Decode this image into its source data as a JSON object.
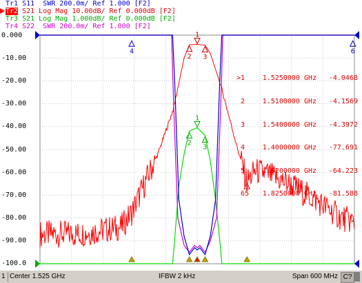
{
  "traces": [
    {
      "id": "Tr1",
      "text": "S11  SWR 200.0m/ Ref 1.000 [F2]",
      "color": "#0000cc",
      "active": false
    },
    {
      "id": "Tr2",
      "text": "S21 Log Mag 10.00dB/ Ref 0.000dB [F2]",
      "color": "#dd0000",
      "active": true
    },
    {
      "id": "Tr3",
      "text": "S21 Log Mag 1.000dB/ Ref 0.000dB [F2]",
      "color": "#00aa00",
      "active": false
    },
    {
      "id": "Tr4",
      "text": "S22  SWR 200.0m/ Ref 1.000 [F2]",
      "color": "#cc00cc",
      "active": false
    }
  ],
  "y_axis_labels": [
    "0.000",
    "-10.00",
    "-20.00",
    "-30.00",
    "-40.00",
    "-50.00",
    "-60.00",
    "-70.00",
    "-80.00",
    "-90.00",
    "-100.0"
  ],
  "markers": [
    {
      "id": ">1",
      "freq": "1.5250000 GHz",
      "value": "-4.0468 dB"
    },
    {
      "id": "2",
      "freq": "1.5100000 GHz",
      "value": "-4.1569 dB"
    },
    {
      "id": "3",
      "freq": "1.5400000 GHz",
      "value": "-4.3972 dB"
    },
    {
      "id": "4",
      "freq": "1.4000000 GHz",
      "value": "-77.691 dB"
    },
    {
      "id": "5",
      "freq": "1.6200000 GHz",
      "value": "-64.223 dB"
    },
    {
      "id": "6",
      "freq": "1.8250000 GHz",
      "value": "-81.588 dB"
    }
  ],
  "chart_data": {
    "type": "line",
    "x_label": "",
    "x_range_ghz": [
      1.225,
      1.825
    ],
    "ylim": [
      -100,
      0
    ],
    "grid": true,
    "series": [
      {
        "name": "Tr2 S21 Log Mag 10.00dB/",
        "color": "#ff0000",
        "x": [
          1.225,
          1.3,
          1.38,
          1.4,
          1.45,
          1.48,
          1.5,
          1.51,
          1.525,
          1.54,
          1.55,
          1.56,
          1.57,
          1.6,
          1.62,
          1.635,
          1.65,
          1.7,
          1.75,
          1.8,
          1.825
        ],
        "y": [
          -87,
          -87,
          -84,
          -77.7,
          -52,
          -32,
          -10,
          -4.2,
          -4.05,
          -4.4,
          -8,
          -15,
          -22,
          -48,
          -64.2,
          -59.5,
          -60,
          -65,
          -72,
          -80,
          -81.6
        ]
      },
      {
        "name": "Tr3 S21 Log Mag 1.000dB/",
        "color": "#00dd00",
        "x": [
          1.225,
          1.478,
          1.481,
          1.49,
          1.5,
          1.51,
          1.525,
          1.54,
          1.55,
          1.56,
          1.569,
          1.572,
          1.825
        ],
        "y": [
          -100,
          -100,
          -92,
          -66,
          -52,
          -42,
          -40.5,
          -43.9,
          -55,
          -72,
          -92,
          -100,
          -100
        ]
      },
      {
        "name": "Tr1 S11 SWR 200.0m/",
        "color": "#0000cc",
        "x": [
          1.225,
          1.47,
          1.478,
          1.482,
          1.49,
          1.5,
          1.51,
          1.52,
          1.525,
          1.53,
          1.54,
          1.55,
          1.56,
          1.568,
          1.572,
          1.58,
          1.825
        ],
        "y": [
          0,
          0,
          0,
          -20,
          -72,
          -88,
          -96,
          -93,
          -94,
          -93,
          -96,
          -88,
          -72,
          -20,
          0,
          0,
          0
        ]
      },
      {
        "name": "Tr4 S22 SWR 200.0m/",
        "color": "#cc00cc",
        "x": [
          1.225,
          1.47,
          1.476,
          1.48,
          1.488,
          1.5,
          1.51,
          1.52,
          1.525,
          1.53,
          1.54,
          1.55,
          1.562,
          1.57,
          1.574,
          1.58,
          1.825
        ],
        "y": [
          0,
          0,
          0,
          -30,
          -80,
          -92,
          -95,
          -92,
          -93,
          -92,
          -95,
          -90,
          -80,
          -30,
          0,
          0,
          0
        ]
      }
    ]
  },
  "status": {
    "channel": "1",
    "center": "Center 1.525 GHz",
    "ifbw": "IFBW 2 kHz",
    "span": "Span 600 MHz",
    "c7": "C?"
  }
}
